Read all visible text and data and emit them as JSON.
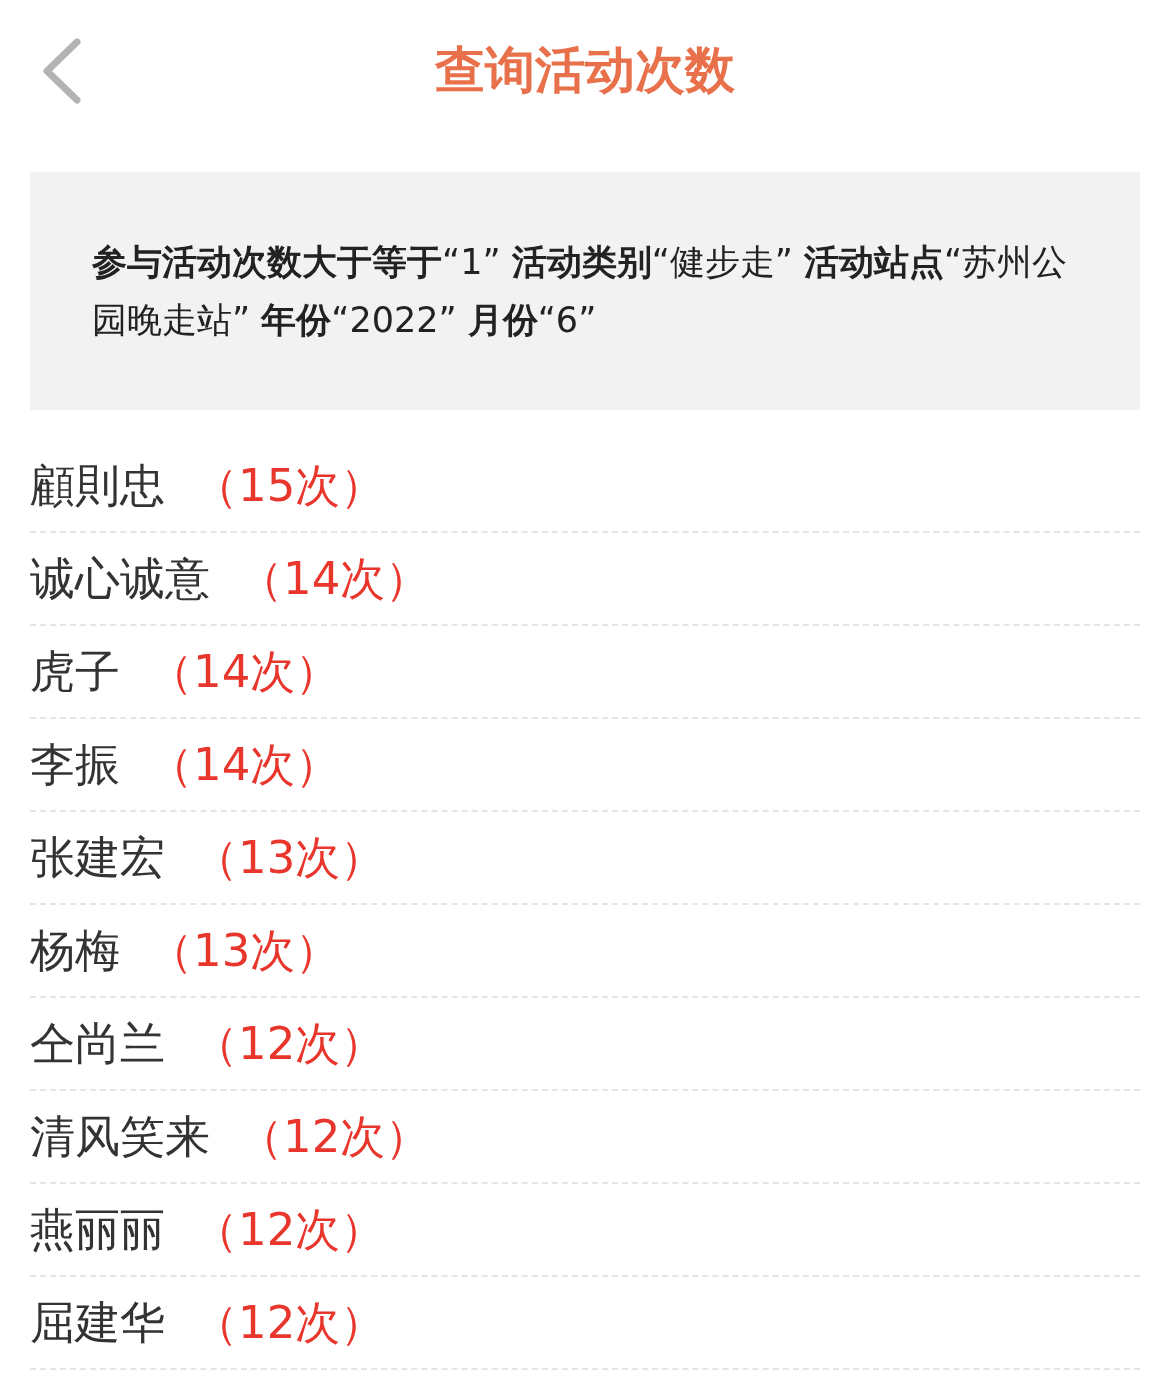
{
  "header": {
    "title": "查询活动次数"
  },
  "filter": {
    "text": "**参与活动次数大于等于**“1” **活动类别**“健步走” **活动站点**“苏州公园晚走站” **年份**“2022” **月份**“6”"
  },
  "rows": [
    {
      "name": "顧則忠",
      "count": "（15次）"
    },
    {
      "name": "诚心诚意",
      "count": "（14次）"
    },
    {
      "name": "虎子",
      "count": "（14次）"
    },
    {
      "name": "李振",
      "count": "（14次）"
    },
    {
      "name": "张建宏",
      "count": "（13次）"
    },
    {
      "name": "杨梅",
      "count": "（13次）"
    },
    {
      "name": "仝尚兰",
      "count": "（12次）"
    },
    {
      "name": "清风笑来",
      "count": "（12次）"
    },
    {
      "name": "燕丽丽",
      "count": "（12次）"
    },
    {
      "name": "屈建华",
      "count": "（12次）"
    }
  ]
}
